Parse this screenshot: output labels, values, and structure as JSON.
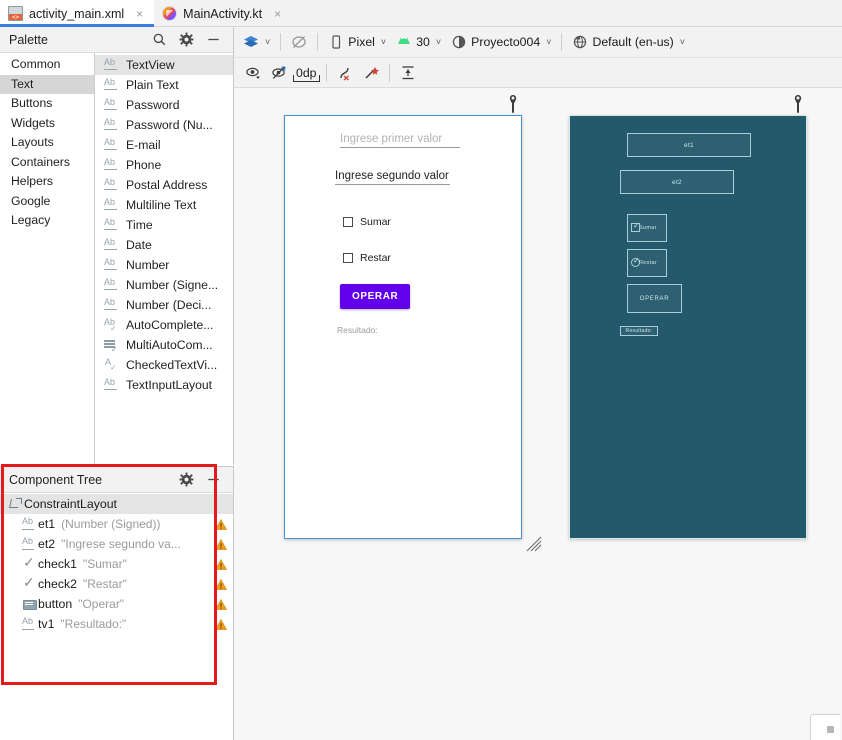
{
  "window": {
    "tabs": [
      {
        "label": "activity_main.xml",
        "icon": "xml-file-icon",
        "active": true,
        "close": "×"
      },
      {
        "label": "MainActivity.kt",
        "icon": "kotlin-file-icon",
        "active": false,
        "close": "×"
      }
    ]
  },
  "palette": {
    "title": "Palette",
    "icons": {
      "search": "search-icon",
      "gear": "gear-icon",
      "minimize": "minimize-icon"
    },
    "categories": [
      {
        "label": "Common",
        "selected": false
      },
      {
        "label": "Text",
        "selected": true
      },
      {
        "label": "Buttons",
        "selected": false
      },
      {
        "label": "Widgets",
        "selected": false
      },
      {
        "label": "Layouts",
        "selected": false
      },
      {
        "label": "Containers",
        "selected": false
      },
      {
        "label": "Helpers",
        "selected": false
      },
      {
        "label": "Google",
        "selected": false
      },
      {
        "label": "Legacy",
        "selected": false
      }
    ],
    "items": [
      {
        "label": "TextView",
        "icon": "ab-underline-icon",
        "selected": true
      },
      {
        "label": "Plain Text",
        "icon": "ab-underline-icon",
        "selected": false
      },
      {
        "label": "Password",
        "icon": "ab-underline-icon",
        "selected": false
      },
      {
        "label": "Password (Nu...",
        "icon": "ab-underline-icon",
        "selected": false
      },
      {
        "label": "E-mail",
        "icon": "ab-underline-icon",
        "selected": false
      },
      {
        "label": "Phone",
        "icon": "ab-underline-icon",
        "selected": false
      },
      {
        "label": "Postal Address",
        "icon": "ab-underline-icon",
        "selected": false
      },
      {
        "label": "Multiline Text",
        "icon": "ab-underline-icon",
        "selected": false
      },
      {
        "label": "Time",
        "icon": "ab-underline-icon",
        "selected": false
      },
      {
        "label": "Date",
        "icon": "ab-underline-icon",
        "selected": false
      },
      {
        "label": "Number",
        "icon": "ab-underline-icon",
        "selected": false
      },
      {
        "label": "Number (Signe...",
        "icon": "ab-underline-icon",
        "selected": false
      },
      {
        "label": "Number (Deci...",
        "icon": "ab-underline-icon",
        "selected": false
      },
      {
        "label": "AutoComplete...",
        "icon": "ab-check-icon",
        "selected": false
      },
      {
        "label": "MultiAutoCom...",
        "icon": "list-check-icon",
        "selected": false
      },
      {
        "label": "CheckedTextVi...",
        "icon": "a-check-icon",
        "selected": false
      },
      {
        "label": "TextInputLayout",
        "icon": "ab-underline-icon",
        "selected": false
      }
    ]
  },
  "component_tree": {
    "title": "Component Tree",
    "icons": {
      "gear": "gear-icon",
      "minimize": "minimize-icon"
    },
    "rows": [
      {
        "icon": "constraint-layout-icon",
        "name": "ConstraintLayout",
        "value": "",
        "warning": false,
        "selected": true,
        "depth": 1
      },
      {
        "icon": "textfield-icon",
        "name": "et1",
        "value": "(Number (Signed))",
        "warning": true,
        "selected": false,
        "depth": 2
      },
      {
        "icon": "textfield-icon",
        "name": "et2",
        "value": "\"Ingrese segundo va...",
        "warning": true,
        "selected": false,
        "depth": 2
      },
      {
        "icon": "checkbox-icon",
        "name": "check1",
        "value": "\"Sumar\"",
        "warning": true,
        "selected": false,
        "depth": 2
      },
      {
        "icon": "checkbox-icon",
        "name": "check2",
        "value": "\"Restar\"",
        "warning": true,
        "selected": false,
        "depth": 2
      },
      {
        "icon": "button-icon",
        "name": "button",
        "value": "\"Operar\"",
        "warning": true,
        "selected": false,
        "depth": 2
      },
      {
        "icon": "textview-icon",
        "name": "tv1",
        "value": "\"Resultado:\"",
        "warning": true,
        "selected": false,
        "depth": 2
      }
    ]
  },
  "design_toolbar": {
    "row1": [
      {
        "type": "icon",
        "name": "design-mode-icon",
        "label": ""
      },
      {
        "type": "sep"
      },
      {
        "type": "icon",
        "name": "no-constraints-icon",
        "label": ""
      },
      {
        "type": "sep"
      },
      {
        "type": "dropdown",
        "name": "device-selector",
        "icon": "phone-icon",
        "label": "Pixel",
        "caret": "˅"
      },
      {
        "type": "dropdown",
        "name": "api-level-selector",
        "icon": "android-icon",
        "label": "30",
        "caret": "˅"
      },
      {
        "type": "dropdown",
        "name": "theme-selector",
        "icon": "theme-icon",
        "label": "Proyecto004",
        "caret": "˅"
      },
      {
        "type": "sep"
      },
      {
        "type": "dropdown",
        "name": "locale-selector",
        "icon": "globe-icon",
        "label": "Default (en-us)",
        "caret": "˅"
      }
    ],
    "row2": [
      {
        "name": "view-options-icon",
        "label": ""
      },
      {
        "name": "toggle-visibility-constraints-icon",
        "label": ""
      },
      {
        "name": "default-margin-value",
        "label": "0dp"
      },
      {
        "name": "clear-constraints-icon",
        "label": ""
      },
      {
        "name": "infer-constraints-icon",
        "label": ""
      },
      {
        "name": "pack-align-icon",
        "label": ""
      }
    ]
  },
  "canvas": {
    "design_device": {
      "name": "design-preview",
      "wrench": "wrench-icon",
      "fields": [
        {
          "id": "et1",
          "text": "Ingrese primer valor",
          "hint": true
        },
        {
          "id": "et2",
          "text": "Ingrese segundo valor",
          "hint": false
        }
      ],
      "checkboxes": [
        {
          "id": "check1",
          "label": "Sumar",
          "checked": false
        },
        {
          "id": "check2",
          "label": "Restar",
          "checked": false
        }
      ],
      "button": {
        "id": "button",
        "label": "OPERAR",
        "color": "#6200ee"
      },
      "result": {
        "id": "tv1",
        "label": "Resultado:"
      }
    },
    "blueprint_device": {
      "name": "blueprint-preview",
      "wrench": "wrench-icon",
      "background": "#24596b",
      "stroke": "#a7cdd8",
      "boxes": [
        {
          "id": "bp-et1",
          "label": "et1"
        },
        {
          "id": "bp-et2",
          "label": "et2"
        },
        {
          "id": "bp-check1",
          "label": "Sumar"
        },
        {
          "id": "bp-check2",
          "label": "Restar"
        },
        {
          "id": "bp-button",
          "label": "OPERAR"
        },
        {
          "id": "bp-tv1",
          "label": "Resultado:"
        }
      ]
    },
    "resize_handle": "resize-handle-icon"
  },
  "annotation": {
    "name": "red-highlight-rectangle",
    "color": "#e51b1b"
  }
}
